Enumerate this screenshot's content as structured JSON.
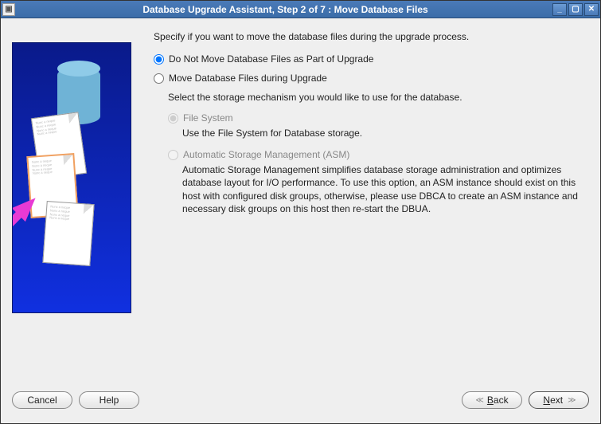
{
  "window": {
    "title": "Database Upgrade Assistant, Step 2 of 7 : Move Database Files"
  },
  "main": {
    "instruction": "Specify if you want to move the database files during the upgrade process.",
    "opt_no_move": "Do Not Move Database Files as Part of Upgrade",
    "opt_move": "Move Database Files during Upgrade",
    "storage_intro": "Select the storage mechanism you would like to use for the database.",
    "fs_label": "File System",
    "fs_desc": "Use the File System for Database storage.",
    "asm_label": "Automatic Storage Management (ASM)",
    "asm_desc": "Automatic Storage Management simplifies database storage administration and optimizes database layout for I/O performance. To use this option, an ASM instance should exist on this host with configured disk groups, otherwise, please use DBCA to create an ASM instance and necessary disk groups on this host then re-start the DBUA."
  },
  "buttons": {
    "cancel": "Cancel",
    "help": "Help",
    "back": "Back",
    "next": "Next"
  }
}
